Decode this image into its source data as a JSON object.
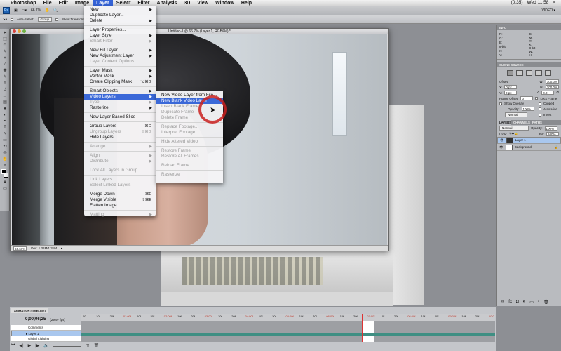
{
  "menubar": {
    "apple": "",
    "items": [
      "Photoshop",
      "File",
      "Edit",
      "Image",
      "Layer",
      "Select",
      "Filter",
      "Analysis",
      "3D",
      "View",
      "Window",
      "Help"
    ],
    "active": "Layer",
    "status": {
      "battery": "(0:35)",
      "clock": "Wed 11:58"
    }
  },
  "appbar": {
    "ps_logo": "Ps",
    "zoom": "66.7%",
    "workspace": "VIDEO ▾"
  },
  "optbar": {
    "auto_select": "Auto-Select:",
    "group": "Group",
    "show_transform": "Show Transform Controls"
  },
  "document": {
    "title": "Untitled-1 @ 66.7% (Layer 1, RGB/8#) *",
    "zoom": "66.67%",
    "doc_size": "Doc: 1.31M/1.31M"
  },
  "layer_menu": {
    "items": [
      {
        "label": "New",
        "sub": true
      },
      {
        "label": "Duplicate Layer..."
      },
      {
        "label": "Delete",
        "sub": true
      },
      {
        "sep": true
      },
      {
        "label": "Layer Properties..."
      },
      {
        "label": "Layer Style",
        "sub": true
      },
      {
        "label": "Smart Filter",
        "sub": true,
        "disabled": true
      },
      {
        "sep": true
      },
      {
        "label": "New Fill Layer",
        "sub": true
      },
      {
        "label": "New Adjustment Layer",
        "sub": true
      },
      {
        "label": "Layer Content Options...",
        "disabled": true
      },
      {
        "sep": true
      },
      {
        "label": "Layer Mask",
        "sub": true
      },
      {
        "label": "Vector Mask",
        "sub": true
      },
      {
        "label": "Create Clipping Mask",
        "shortcut": "⌥⌘G"
      },
      {
        "sep": true
      },
      {
        "label": "Smart Objects",
        "sub": true
      },
      {
        "label": "Video Layers",
        "sub": true,
        "highlight": true
      },
      {
        "label": "Type",
        "sub": true,
        "disabled": true
      },
      {
        "label": "Rasterize",
        "sub": true
      },
      {
        "sep": true
      },
      {
        "label": "New Layer Based Slice"
      },
      {
        "sep": true
      },
      {
        "label": "Group Layers",
        "shortcut": "⌘G"
      },
      {
        "label": "Ungroup Layers",
        "shortcut": "⇧⌘G",
        "disabled": true
      },
      {
        "label": "Hide Layers"
      },
      {
        "sep": true
      },
      {
        "label": "Arrange",
        "sub": true,
        "disabled": true
      },
      {
        "sep": true
      },
      {
        "label": "Align",
        "sub": true,
        "disabled": true
      },
      {
        "label": "Distribute",
        "sub": true,
        "disabled": true
      },
      {
        "sep": true
      },
      {
        "label": "Lock All Layers in Group...",
        "disabled": true
      },
      {
        "sep": true
      },
      {
        "label": "Link Layers",
        "disabled": true
      },
      {
        "label": "Select Linked Layers",
        "disabled": true
      },
      {
        "sep": true
      },
      {
        "label": "Merge Down",
        "shortcut": "⌘E"
      },
      {
        "label": "Merge Visible",
        "shortcut": "⇧⌘E"
      },
      {
        "label": "Flatten Image"
      },
      {
        "sep": true
      },
      {
        "label": "Matting",
        "sub": true,
        "disabled": true
      }
    ]
  },
  "video_submenu": {
    "items": [
      {
        "label": "New Video Layer from File..."
      },
      {
        "label": "New Blank Video Layer",
        "highlight": true
      },
      {
        "label": "Insert Blank Frame",
        "disabled": true
      },
      {
        "label": "Duplicate Frame",
        "disabled": true
      },
      {
        "label": "Delete Frame",
        "disabled": true
      },
      {
        "sep": true
      },
      {
        "label": "Replace Footage...",
        "disabled": true
      },
      {
        "label": "Interpret Footage...",
        "disabled": true
      },
      {
        "sep": true
      },
      {
        "label": "Hide Altered Video",
        "disabled": true
      },
      {
        "sep": true
      },
      {
        "label": "Restore Frame",
        "disabled": true
      },
      {
        "label": "Restore All Frames",
        "disabled": true
      },
      {
        "sep": true
      },
      {
        "label": "Reload Frame",
        "disabled": true
      },
      {
        "sep": true
      },
      {
        "label": "Rasterize",
        "disabled": true
      }
    ]
  },
  "panels": {
    "info": {
      "tab": "INFO",
      "left": [
        "R:",
        "G:",
        "B:",
        "8-bit"
      ],
      "right": [
        "C:",
        "M:",
        "Y:",
        "K:",
        "8-bit"
      ],
      "xy": [
        "X:",
        "Y:"
      ],
      "wh": [
        "W:",
        "H:"
      ]
    },
    "clone": {
      "tab": "CLONE SOURCE",
      "offset": "Offset:",
      "x_label": "X:",
      "x": "0 px",
      "y_label": "Y:",
      "y": "0 px",
      "w_label": "W:",
      "w": "100.0%",
      "h_label": "H:",
      "h": "100.0%",
      "angle": "0.0",
      "frame_offset": "Frame Offset:",
      "frame_offset_val": "0",
      "lock_frame": "Lock Frame",
      "show_overlay": "Show Overlay",
      "clipped": "Clipped",
      "opacity_label": "Opacity:",
      "opacity": "100%",
      "auto_hide": "Auto Hide",
      "blend": "Normal",
      "invert": "Invert"
    },
    "layers": {
      "tabs": [
        "LAYERS",
        "CHANNELS",
        "PATHS"
      ],
      "blend": "Normal",
      "opacity_label": "Opacity:",
      "opacity": "100%",
      "lock": "Lock:",
      "fill_label": "Fill:",
      "fill": "100%",
      "items": [
        "Layer 1",
        "Background"
      ]
    }
  },
  "timeline": {
    "tab": "ANIMATION (TIMELINE)",
    "time": "0;00;06;25",
    "fps": "(29.97 fps)",
    "rows": [
      "Comments",
      "Layer 1",
      "Global Lighting"
    ],
    "ticks": [
      "00",
      "10f",
      "20f",
      "01:00f",
      "10f",
      "20f",
      "02:00f",
      "10f",
      "20f",
      "03:00f",
      "10f",
      "20f",
      "04:00f",
      "10f",
      "20f",
      "05:00f",
      "10f",
      "20f",
      "06:00f",
      "10f",
      "20f",
      "07:00f",
      "10f",
      "20f",
      "08:00f",
      "10f",
      "20f",
      "09:00f",
      "10f",
      "20f",
      "10:0"
    ]
  }
}
